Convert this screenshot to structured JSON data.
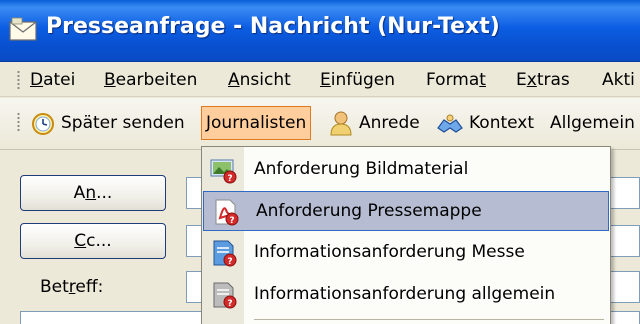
{
  "window": {
    "title": "Presseanfrage - Nachricht (Nur-Text)"
  },
  "menubar": {
    "items": [
      {
        "mnemonic": "D",
        "rest": "atei"
      },
      {
        "mnemonic": "B",
        "rest": "earbeiten"
      },
      {
        "mnemonic": "A",
        "rest": "nsicht"
      },
      {
        "mnemonic": "E",
        "rest": "infügen"
      },
      {
        "pre": "Forma",
        "mnemonic": "t",
        "rest": ""
      },
      {
        "pre": "E",
        "mnemonic": "x",
        "rest": "tras"
      },
      {
        "pre": "Akti",
        "mnemonic": "",
        "rest": ""
      }
    ]
  },
  "toolbar": {
    "spaeter_senden": "Später senden",
    "journalisten": "Journalisten",
    "anrede": "Anrede",
    "kontext": "Kontext",
    "allgemein": "Allgemein"
  },
  "form": {
    "an_pre": "A",
    "an_mnemonic": "n",
    "an_rest": "...",
    "cc_pre": "",
    "cc_mnemonic": "C",
    "cc_rest": "c...",
    "betreff_pre": "Bet",
    "betreff_mnemonic": "r",
    "betreff_rest": "eff:"
  },
  "dropdown": {
    "items": [
      {
        "label": "Anforderung Bildmaterial",
        "icon": "image-document-icon"
      },
      {
        "label": "Anforderung Pressemappe",
        "icon": "pdf-document-icon",
        "highlighted": true
      },
      {
        "label": "Informationsanforderung Messe",
        "icon": "blue-document-icon"
      },
      {
        "label": "Informationsanforderung allgemein",
        "icon": "gray-document-icon"
      }
    ]
  },
  "colors": {
    "titlebar": "#0a5fd8",
    "highlight": "#b6bdd2",
    "highlight_border": "#316ac5",
    "active_toolbar_button": "#ffce9c"
  }
}
